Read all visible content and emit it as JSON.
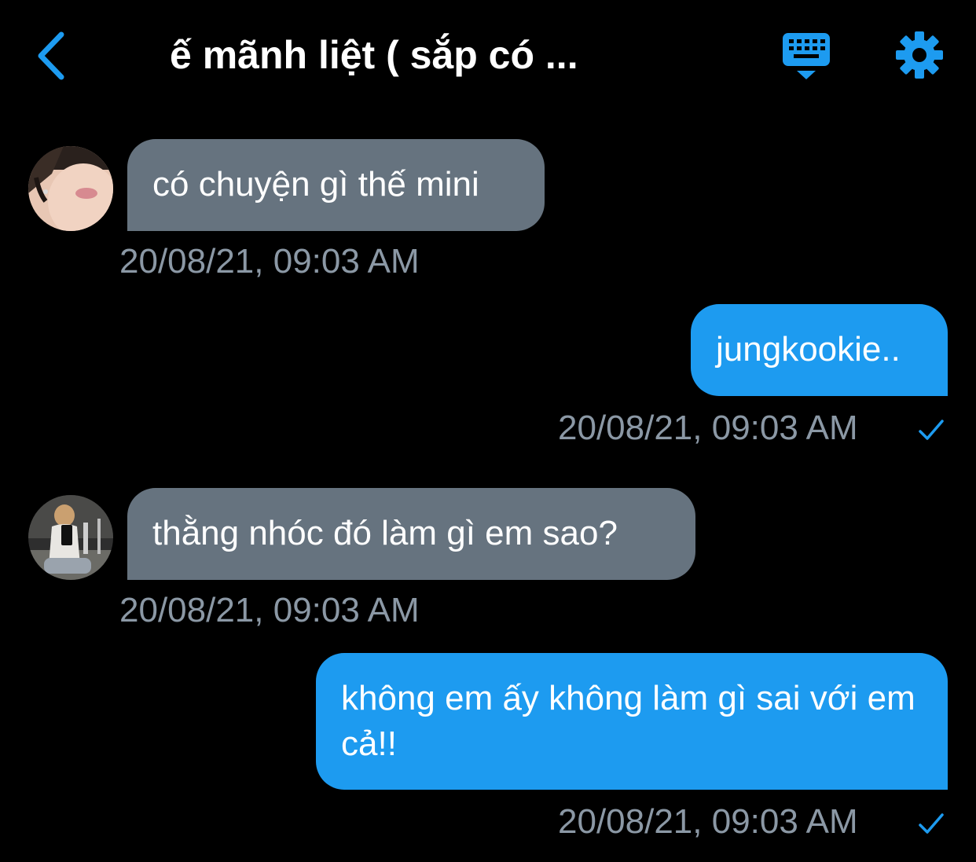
{
  "header": {
    "title": "ế mãnh liệt ( sắp có ...",
    "back_icon": "chevron-left-icon",
    "keyboard_icon": "keyboard-icon",
    "settings_icon": "gear-icon"
  },
  "colors": {
    "accent": "#1d9bf0",
    "received_bubble": "#66737f",
    "timestamp": "#8b98a5",
    "background": "#000000"
  },
  "messages": [
    {
      "direction": "received",
      "text": "có chuyện gì thế mini",
      "time": "20/08/21, 09:03 AM"
    },
    {
      "direction": "sent",
      "text": "jungkookie..",
      "time": "20/08/21, 09:03 AM",
      "status_icon": "check-icon"
    },
    {
      "direction": "received",
      "text": "thằng nhóc đó làm gì em sao?",
      "time": "20/08/21, 09:03 AM"
    },
    {
      "direction": "sent",
      "text": "không em ấy không làm gì sai với em cả!!",
      "time": "20/08/21, 09:03 AM",
      "status_icon": "check-icon"
    }
  ]
}
